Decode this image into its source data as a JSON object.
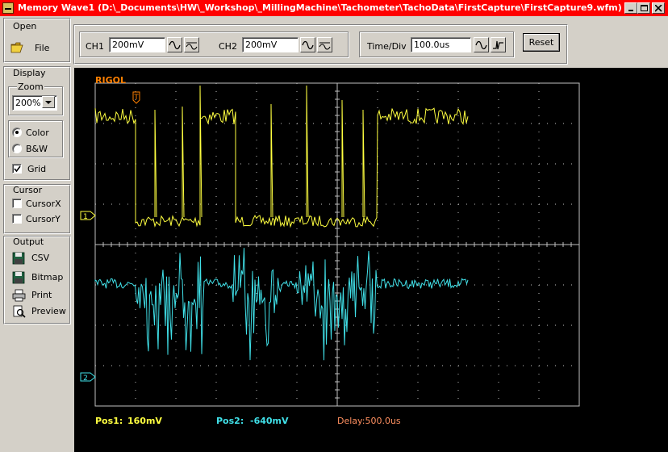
{
  "window": {
    "title": "Memory Wave1  (D:\\_Documents\\HW\\_Workshop\\_MillingMachine\\Tachometer\\TachoData\\FirstCapture\\FirstCapture9.wfm)"
  },
  "sidebar": {
    "open": {
      "label": "Open",
      "file_label": "File"
    },
    "display": {
      "label": "Display",
      "zoom_label": "Zoom",
      "zoom_value": "200%",
      "color_label": "Color",
      "bw_label": "B&W",
      "grid_label": "Grid",
      "color_selected": true,
      "grid_checked": true
    },
    "cursor": {
      "label": "Cursor",
      "cursor_x_label": "CursorX",
      "cursor_y_label": "CursorY"
    },
    "output": {
      "label": "Output",
      "csv_label": "CSV",
      "bitmap_label": "Bitmap",
      "print_label": "Print",
      "preview_label": "Preview"
    }
  },
  "toolbar": {
    "ch1_label": "CH1",
    "ch1_value": "200mV",
    "ch2_label": "CH2",
    "ch2_value": "200mV",
    "timediv_label": "Time/Div",
    "timediv_value": "100.0us",
    "reset_label": "Reset"
  },
  "scope": {
    "brand": "RIGOL",
    "trigger_marker": "T",
    "ch1_marker": "1",
    "ch2_marker": "2",
    "pos1_label": "Pos1:",
    "pos1_value": "160mV",
    "pos2_label": "Pos2:",
    "pos2_value": "-640mV",
    "delay_text": "Delay:500.0us",
    "colors": {
      "ch1": "#ffff40",
      "ch2": "#40e0e8",
      "brand": "#ff8000",
      "grid": "#c0c0c0",
      "delay": "#ff9060",
      "background": "#000000"
    }
  }
}
